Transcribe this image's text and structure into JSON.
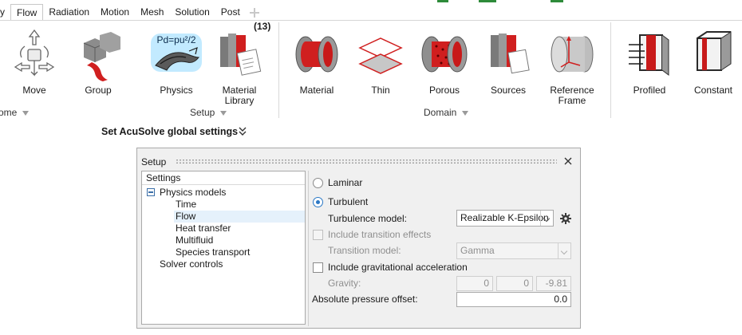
{
  "menu": {
    "items": [
      {
        "label": "y",
        "active": false
      },
      {
        "label": "Flow",
        "active": true
      },
      {
        "label": "Radiation",
        "active": false
      },
      {
        "label": "Motion",
        "active": false
      },
      {
        "label": "Mesh",
        "active": false
      },
      {
        "label": "Solution",
        "active": false
      },
      {
        "label": "Post",
        "active": false
      }
    ]
  },
  "ribbon": {
    "tools": [
      {
        "label": "Move",
        "icon": "move-icon"
      },
      {
        "label": "Group",
        "icon": "group-icon"
      },
      {
        "label": "Physics",
        "icon": "physics-icon",
        "formula": "Pd=pu²/2"
      },
      {
        "label": "Material Library",
        "icon": "material-library-icon",
        "badge": "(13)"
      },
      {
        "label": "Material",
        "icon": "material-icon"
      },
      {
        "label": "Thin",
        "icon": "thin-icon"
      },
      {
        "label": "Porous",
        "icon": "porous-icon"
      },
      {
        "label": "Sources",
        "icon": "sources-icon"
      },
      {
        "label": "Reference Frame",
        "icon": "reference-frame-icon"
      },
      {
        "label": "Profiled",
        "icon": "profiled-icon"
      },
      {
        "label": "Constant",
        "icon": "constant-icon"
      }
    ],
    "groups": [
      {
        "label": "ome"
      },
      {
        "label": "Setup"
      },
      {
        "label": "Domain"
      }
    ]
  },
  "global_settings": {
    "title": "Set AcuSolve global settings"
  },
  "setup_panel": {
    "title": "Setup",
    "tree": {
      "header": "Settings",
      "items": [
        {
          "label": "Physics models",
          "level": 0,
          "selected": false
        },
        {
          "label": "Time",
          "level": 1,
          "selected": false
        },
        {
          "label": "Flow",
          "level": 1,
          "selected": true
        },
        {
          "label": "Heat transfer",
          "level": 1,
          "selected": false
        },
        {
          "label": "Multifluid",
          "level": 1,
          "selected": false
        },
        {
          "label": "Species transport",
          "level": 1,
          "selected": false
        },
        {
          "label": "Solver controls",
          "level": 0,
          "selected": false
        }
      ]
    },
    "options": {
      "laminar_label": "Laminar",
      "laminar_selected": false,
      "turbulent_label": "Turbulent",
      "turbulent_selected": true,
      "turbulence_model_label": "Turbulence model:",
      "turbulence_model_value": "Realizable K-Epsilon",
      "transition_effects_label": "Include transition effects",
      "transition_effects_checked": false,
      "transition_model_label": "Transition model:",
      "transition_model_value": "Gamma",
      "gravitational_label": "Include gravitational acceleration",
      "gravitational_checked": false,
      "gravity_label": "Gravity:",
      "gravity_values": [
        "0",
        "0",
        "-9.81"
      ],
      "pressure_offset_label": "Absolute pressure offset:",
      "pressure_offset_value": "0.0"
    }
  },
  "colors": {
    "accent_blue": "#2b78c5",
    "selection": "#e5f1fb",
    "icon_red": "#d01f1f",
    "top_accent_green": "#2e8b3a"
  }
}
